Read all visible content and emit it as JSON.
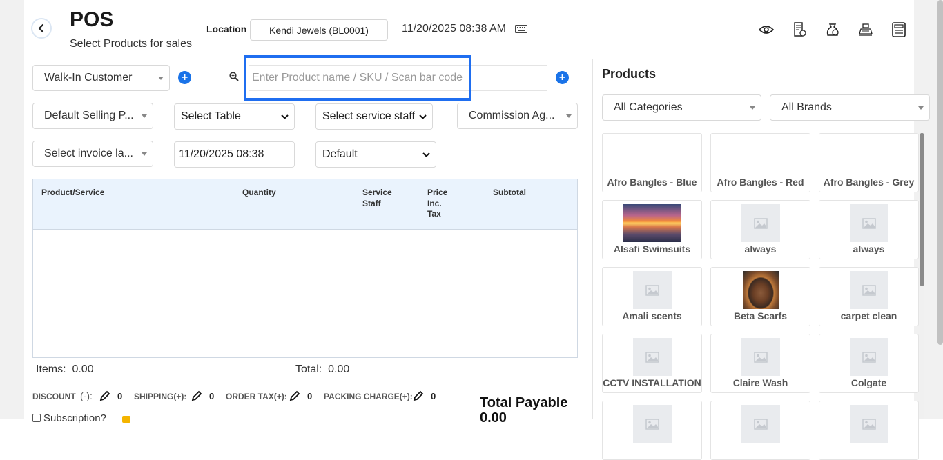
{
  "header": {
    "title": "POS",
    "subtitle": "Select Products for sales",
    "location_label": "Location",
    "location_value": "Kendi Jewels (BL0001)",
    "datetime": "11/20/2025 08:38 AM",
    "icons": [
      "eye-icon",
      "receipt-icon",
      "money-bag-icon",
      "cash-register-icon",
      "calculator-icon"
    ]
  },
  "form": {
    "customer": "Walk-In Customer",
    "search_placeholder": "Enter Product name / SKU / Scan bar code",
    "selling_price_group": "Default Selling P...",
    "table_select": "Select Table",
    "service_staff": "Select service staff",
    "commission_agent": "Commission Ag...",
    "invoice_layout": "Select invoice la...",
    "transaction_date": "11/20/2025 08:38",
    "invoice_scheme": "Default"
  },
  "table": {
    "headers": {
      "product": "Product/Service",
      "quantity": "Quantity",
      "service_staff_1": "Service",
      "service_staff_2": "Staff",
      "price_1": "Price",
      "price_2": "Inc.",
      "price_3": "Tax",
      "subtotal": "Subtotal"
    }
  },
  "totals": {
    "items_label": "Items:",
    "items_value": "0.00",
    "total_label": "Total:",
    "total_value": "0.00",
    "discount_label": "DISCOUNT",
    "discount_sign": "(-):",
    "discount_value": "0",
    "shipping_label": "SHIPPING(+):",
    "shipping_value": "0",
    "order_tax_label": "ORDER TAX(+):",
    "order_tax_value": "0",
    "packing_label": "PACKING CHARGE(+):",
    "packing_value": "0",
    "total_payable_label": "Total Payable",
    "total_payable_value": "0.00",
    "subscription_label": "Subscription?"
  },
  "products_panel": {
    "title": "Products",
    "category_filter": "All Categories",
    "brand_filter": "All Brands",
    "items": [
      {
        "name": "Afro Bangles - Blue",
        "image": "none"
      },
      {
        "name": "Afro Bangles - Red",
        "image": "none"
      },
      {
        "name": "Afro Bangles - Grey",
        "image": "none"
      },
      {
        "name": "Alsafi Swimsuits",
        "image": "sunset-photo"
      },
      {
        "name": "always",
        "image": "placeholder"
      },
      {
        "name": "always",
        "image": "placeholder"
      },
      {
        "name": "Amali scents",
        "image": "placeholder"
      },
      {
        "name": "Beta Scarfs",
        "image": "portrait-photo"
      },
      {
        "name": "carpet clean",
        "image": "placeholder"
      },
      {
        "name": "CCTV INSTALLATION",
        "image": "placeholder"
      },
      {
        "name": "Claire Wash",
        "image": "placeholder"
      },
      {
        "name": "Colgate",
        "image": "placeholder"
      },
      {
        "name": "",
        "image": "placeholder"
      },
      {
        "name": "",
        "image": "placeholder"
      },
      {
        "name": "",
        "image": "placeholder"
      }
    ]
  },
  "colors": {
    "accent": "#1a73e8",
    "search_highlight": "#1f6ef0",
    "table_header_bg": "#eaf3fd"
  }
}
